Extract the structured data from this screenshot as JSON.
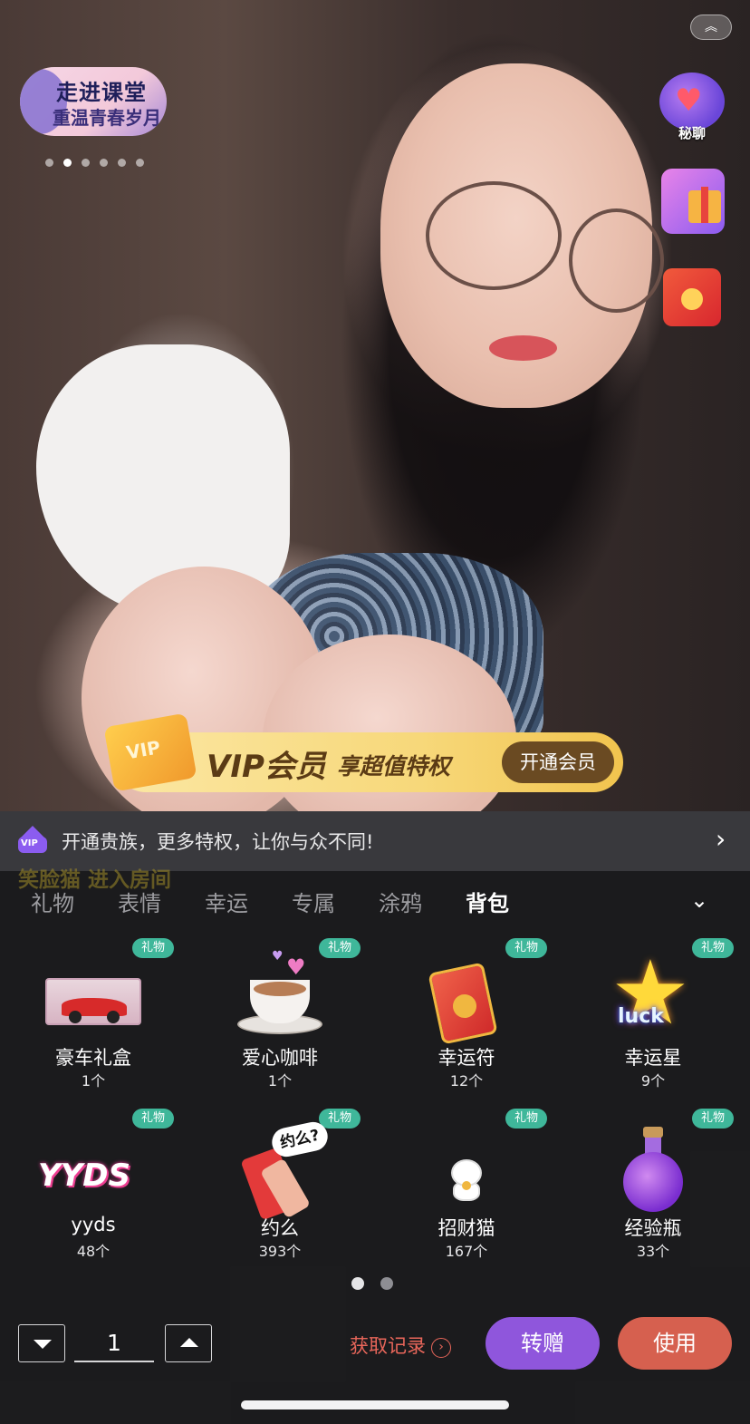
{
  "top": {
    "collapse_icon": "chevron-up-double-icon",
    "activity_banner": {
      "line1": "走进课堂",
      "line2": "重温青春岁月"
    },
    "banner_dots": {
      "count": 6,
      "active_index": 1
    }
  },
  "side": {
    "secret_chat_label": "秘聊",
    "secret_chat_icon": "heart-chat-icon",
    "gift_icon": "gift-box-icon",
    "red_packet_icon": "red-packet-icon"
  },
  "vip_banner": {
    "badge": "VIP",
    "title": "VIP会员",
    "subtitle": "享超值特权",
    "button": "开通会员"
  },
  "noble_bar": {
    "badge": "VIP",
    "text": "开通贵族，更多特权，让你与众不同!"
  },
  "ghost_overlay": {
    "enter_text": "笑脸猫 进入房间"
  },
  "tabs": [
    "礼物",
    "表情",
    "幸运",
    "专属",
    "涂鸦",
    "背包"
  ],
  "active_tab": "背包",
  "gift_tag": "礼物",
  "gifts": [
    {
      "name": "豪车礼盒",
      "count": "1个"
    },
    {
      "name": "爱心咖啡",
      "count": "1个"
    },
    {
      "name": "幸运符",
      "count": "12个"
    },
    {
      "name": "幸运星",
      "count": "9个",
      "art_text": "luck"
    },
    {
      "name": "yyds",
      "count": "48个",
      "art_text": "YYDS"
    },
    {
      "name": "约么",
      "count": "393个",
      "art_text": "约么?"
    },
    {
      "name": "招财猫",
      "count": "167个"
    },
    {
      "name": "经验瓶",
      "count": "33个"
    }
  ],
  "page_dots": {
    "count": 2,
    "active_index": 0
  },
  "quantity": {
    "value": "1"
  },
  "footer": {
    "record_link": "获取记录",
    "give_button": "转赠",
    "use_button": "使用"
  },
  "colors": {
    "tag_green": "#3fb79a",
    "give_purple": "#8f56dc",
    "use_red": "#d6604f",
    "link_red": "#e8665a",
    "vip_gold": "#f7d87a"
  }
}
